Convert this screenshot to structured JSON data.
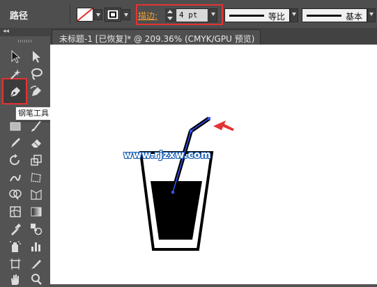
{
  "control_bar": {
    "selection_label": "路径",
    "fill_swatch": "none-swatch",
    "stroke_swatch": "stroke-swatch",
    "stroke_label": "描边",
    "stroke_colon": ":",
    "stroke_weight": "4 pt",
    "profile_label": "等比",
    "brush_label": "基本",
    "highlight_color": "#e53333"
  },
  "tool_panel": {
    "collapse_glyph": "◂◂",
    "tooltip": "钢笔工具 (P)",
    "active_tool": "pen-tool",
    "tools": [
      "selection-tool",
      "direct-selection-tool",
      "magic-wand-tool",
      "lasso-tool",
      "pen-tool",
      "curvature-tool",
      "rectangle-tool",
      "paintbrush-tool",
      "pencil-tool",
      "eraser-tool",
      "rotate-tool",
      "scale-tool",
      "warp-tool",
      "free-transform-tool",
      "shape-builder-tool",
      "perspective-grid-tool",
      "mesh-tool",
      "gradient-tool",
      "eyedropper-tool",
      "blend-tool",
      "symbol-sprayer-tool",
      "column-graph-tool",
      "artboard-tool",
      "slice-tool",
      "hand-tool",
      "zoom-tool"
    ]
  },
  "document": {
    "tab_title": "未标题-1 [已恢复]* @ 209.36% (CMYK/GPU 预览)"
  },
  "artboard": {
    "watermark": "www.rjzxw.com",
    "arrow_color": "#e53333",
    "path_color": "#3355ff"
  }
}
